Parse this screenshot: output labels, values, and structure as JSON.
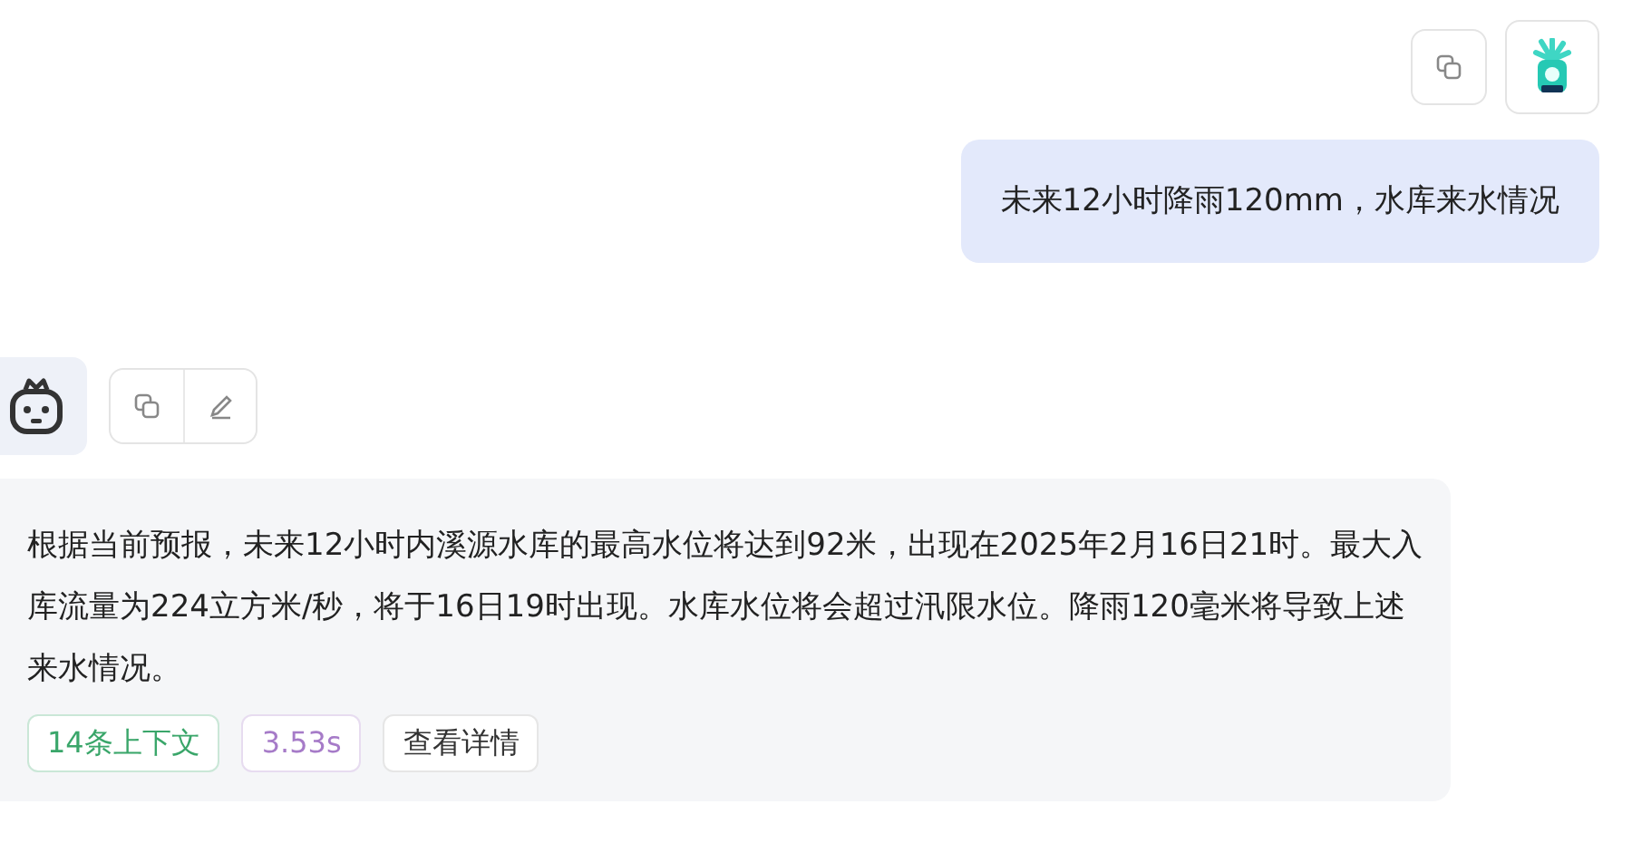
{
  "user_message": {
    "text": "未来12小时降雨120mm，水库来水情况"
  },
  "bot_message": {
    "text": "根据当前预报，未来12小时内溪源水库的最高水位将达到92米，出现在2025年2月16日21时。最大入库流量为224立方米/秒，将于16日19时出现。水库水位将会超过汛限水位。降雨120毫米将导致上述来水情况。",
    "tags": [
      {
        "label": "14条上下文",
        "color": "#3aa66a"
      },
      {
        "label": "3.53s",
        "color": "#a67bc8"
      }
    ],
    "details_button": "查看详情"
  }
}
